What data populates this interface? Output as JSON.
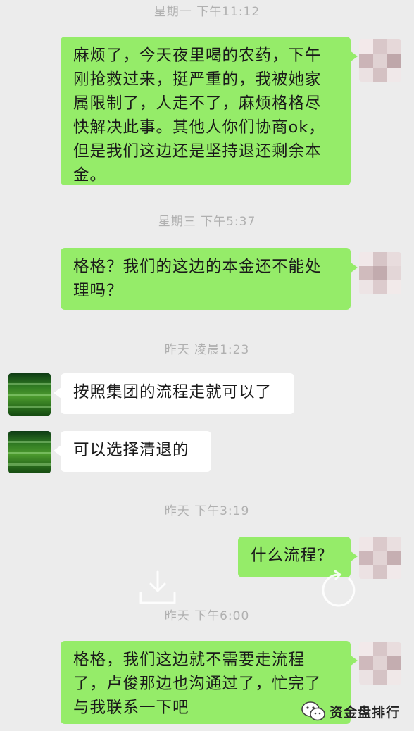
{
  "messages": [
    {
      "kind": "timestamp",
      "text": "星期一 下午11:12"
    },
    {
      "kind": "outgoing",
      "lines": [
        "麻烦了，今天夜里喝的农药，下午",
        "刚抢救过来，挺严重的，我被她家",
        "属限制了，人走不了，麻烦格格尽",
        "快解决此事。其他人你们协商ok，",
        "但是我们这边还是坚持退还剩余本",
        "金。"
      ]
    },
    {
      "kind": "timestamp",
      "text": "星期三 下午5:37"
    },
    {
      "kind": "outgoing",
      "lines": [
        "格格？我们的这边的本金还不能处",
        "理吗？"
      ]
    },
    {
      "kind": "timestamp",
      "text": "昨天 凌晨1:23"
    },
    {
      "kind": "incoming",
      "lines": [
        "按照集团的流程走就可以了"
      ]
    },
    {
      "kind": "incoming",
      "lines": [
        "可以选择清退的"
      ]
    },
    {
      "kind": "timestamp",
      "text": "昨天 下午3:19"
    },
    {
      "kind": "outgoing",
      "lines": [
        "什么流程？"
      ]
    },
    {
      "kind": "timestamp",
      "text": "昨天 下午6:00"
    },
    {
      "kind": "outgoing",
      "lines": [
        "格格，我们这边就不需要走流程",
        "了，卢俊那边也沟通过了，忙完了",
        "与我联系一下吧"
      ]
    }
  ],
  "watermark": {
    "text": "资金盘排行",
    "icon": "wechat-icon"
  },
  "overlay_icons": [
    "download-icon",
    "refresh-icon"
  ],
  "colors": {
    "outgoing_bubble": "#95ec69",
    "incoming_bubble": "#ffffff",
    "background": "#ececec",
    "timestamp": "#b0b0b0"
  }
}
